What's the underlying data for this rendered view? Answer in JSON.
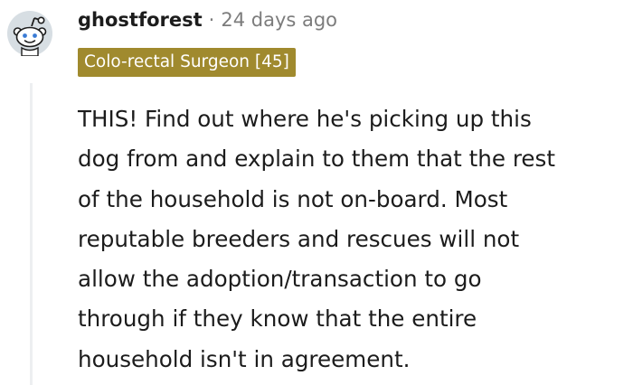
{
  "comment": {
    "username": "ghostforest",
    "separator": "·",
    "timestamp": "24 days ago",
    "flair": "Colo-rectal Surgeon [45]",
    "avatar_icon": "snoo-avatar-icon",
    "body_lines": [
      "THIS! Find out where he's picking up this",
      "dog from and explain to them that the rest",
      "of the household is not on-board. Most",
      "reputable breeders and rescues will not",
      "allow the adoption/transaction to go",
      "through if they know that the entire",
      "household isn't in agreement."
    ]
  },
  "colors": {
    "flair_bg": "#a08a2e",
    "avatar_bg": "#d7dee3",
    "meta_gray": "#7c7c7c",
    "thread_line": "#edeff1"
  }
}
